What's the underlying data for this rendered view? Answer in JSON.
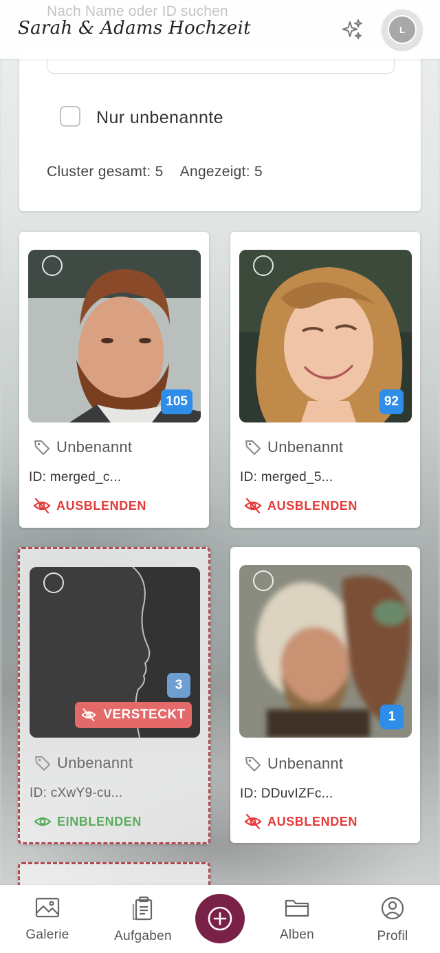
{
  "header": {
    "app_title": "Sarah & Adams Hochzeit",
    "avatar_initial": "L",
    "sparkle_icon": "sparkles-icon"
  },
  "filters": {
    "search_placeholder": "Nach Name oder ID suchen",
    "unnamed_only_label": "Nur unbenannte",
    "unnamed_only_checked": false,
    "clusters_total": "Cluster gesamt: 5",
    "clusters_shown": "Angezeigt: 5"
  },
  "clusters": [
    {
      "name": "Unbenannt",
      "id": "ID: merged_c...",
      "count": "105",
      "action": "AUSBLENDEN",
      "hidden": false
    },
    {
      "name": "Unbenannt",
      "id": "ID: merged_5...",
      "count": "92",
      "action": "AUSBLENDEN",
      "hidden": false
    },
    {
      "name": "Unbenannt",
      "id": "ID: cXwY9-cu...",
      "count": "3",
      "action": "EINBLENDEN",
      "hidden": true,
      "hidden_badge": "VERSTECKT"
    },
    {
      "name": "Unbenannt",
      "id": "ID: DDuvIZFc...",
      "count": "1",
      "action": "AUSBLENDEN",
      "hidden": false
    }
  ],
  "colors": {
    "accent": "#7a2147",
    "count_badge": "#2d8de8",
    "hide_action": "#e23b3b",
    "show_action": "#5cab5f",
    "hidden_border": "#b24a52"
  },
  "nav": {
    "items": [
      {
        "label": "Galerie",
        "icon": "image-icon"
      },
      {
        "label": "Aufgaben",
        "icon": "clipboard-icon"
      },
      {
        "label": "Alben",
        "icon": "folder-icon"
      },
      {
        "label": "Profil",
        "icon": "user-circle-icon"
      }
    ],
    "fab_icon": "plus-circle-icon"
  }
}
